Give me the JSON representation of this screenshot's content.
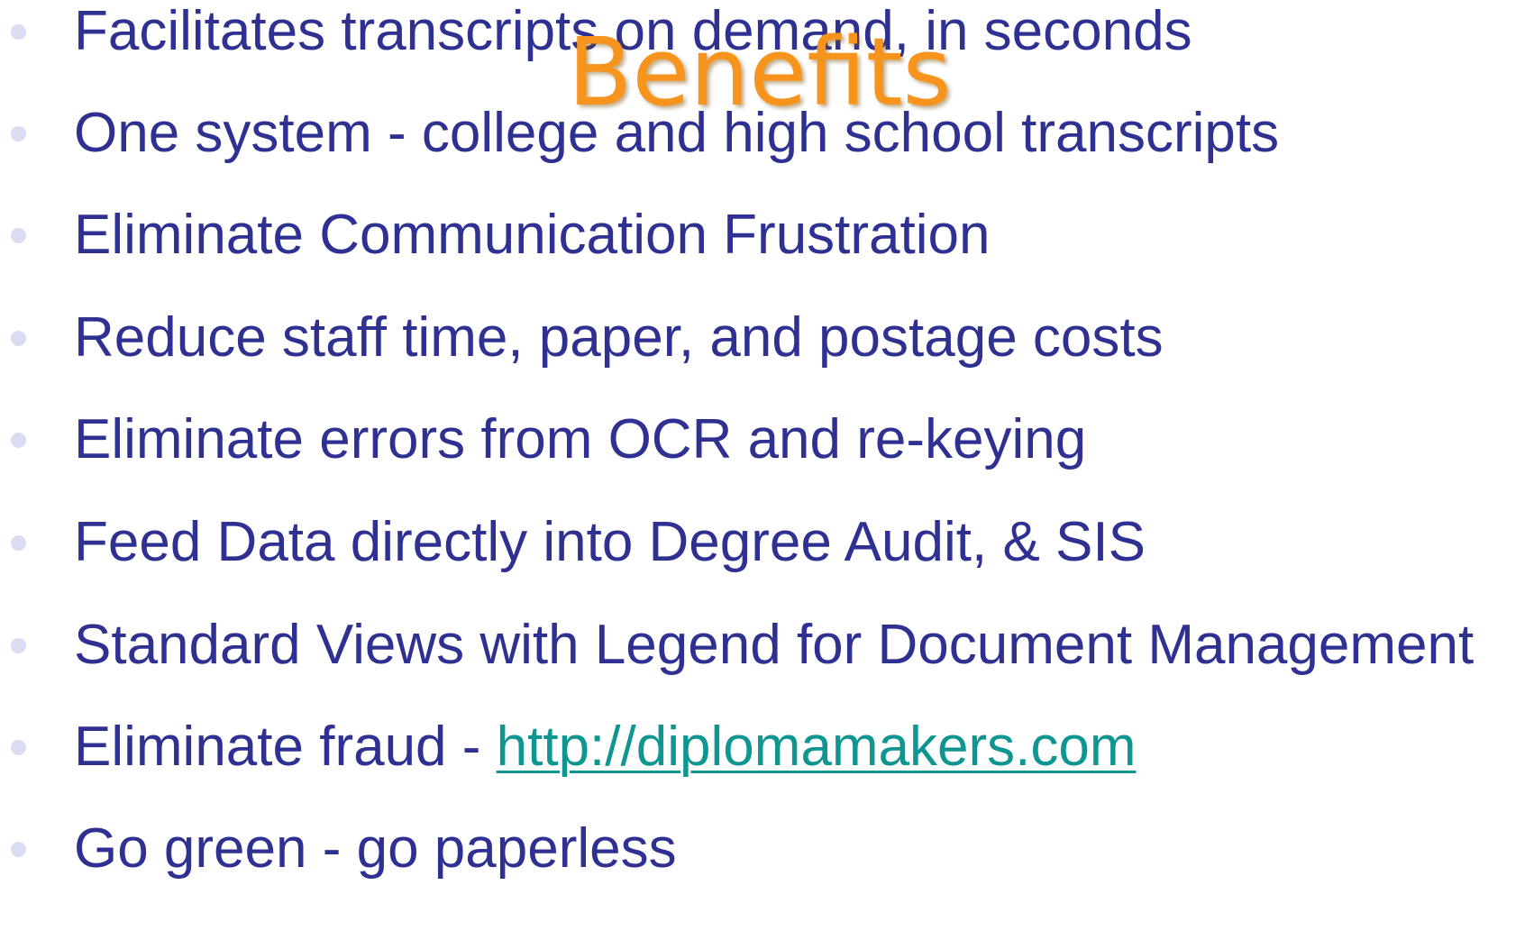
{
  "slide": {
    "title": "Benefits",
    "bullets": [
      {
        "text": "Facilitates transcripts on demand, in seconds"
      },
      {
        "text": "One system - college and high school transcripts"
      },
      {
        "text": "Eliminate Communication Frustration"
      },
      {
        "text": "Reduce staff time, paper, and postage costs"
      },
      {
        "text": "Eliminate errors from OCR and re-keying"
      },
      {
        "text": "Feed Data directly into Degree Audit, & SIS"
      },
      {
        "text": "Standard Views with Legend for Document Management"
      },
      {
        "text": "Eliminate fraud - ",
        "link": "http://diplomamakers.com"
      },
      {
        "text": "Go green - go paperless"
      }
    ]
  },
  "colors": {
    "title": "#f7941d",
    "text": "#2e3192",
    "link": "#0f9690",
    "bullet_dot": "#d9dcf2"
  }
}
